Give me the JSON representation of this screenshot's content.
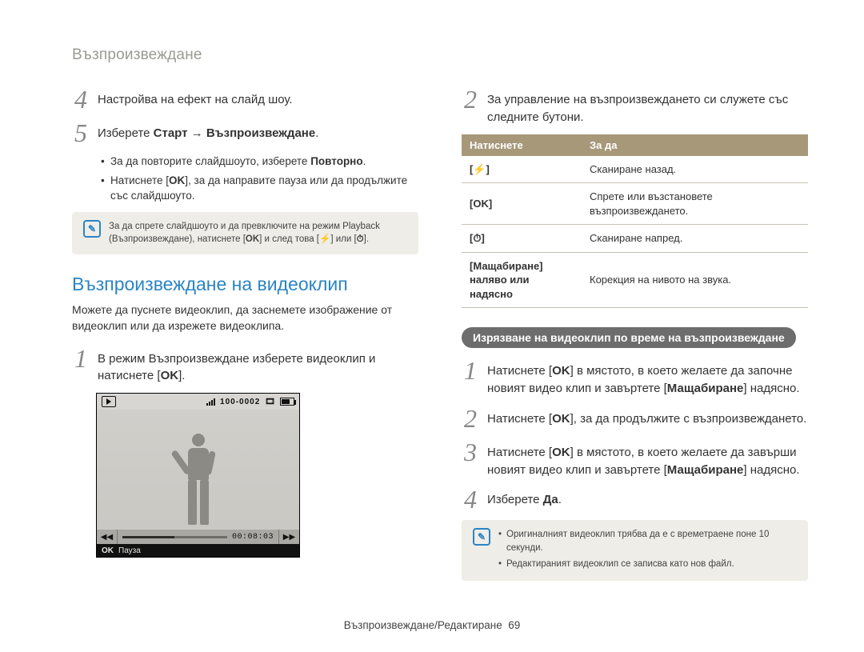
{
  "header": "Възпроизвеждане",
  "left": {
    "step4": "Настройва на ефект на слайд шоу.",
    "step5_pre": "Изберете ",
    "step5_b1": "Старт",
    "step5_arrow": " → ",
    "step5_b2": "Възпроизвеждане",
    "step5_post": ".",
    "bul1_pre": "За да повторите слайдшоуто, изберете ",
    "bul1_b": "Повторно",
    "bul1_post": ".",
    "bul2_pre": "Натиснете [",
    "bul2_ok": "OK",
    "bul2_post": "], за да направите пауза или да продължите със слайдшоуто.",
    "note1_pre": "За да спрете слайдшоуто и да превключите на режим Playback (Възпроизвеждане), натиснете [",
    "note1_ok": "OK",
    "note1_mid": "] и след това [",
    "note1_g1": "⚡",
    "note1_or": "] или [",
    "note1_g2": "⏱",
    "note1_post": "].",
    "h2": "Възпроизвеждане на видеоклип",
    "desc": "Можете да пуснете видеоклип, да заснемете изображение от видеоклип или да изрежете видеоклипа.",
    "step1_pre": "В режим Възпроизвеждане изберете видеоклип и натиснете [",
    "step1_ok": "OK",
    "step1_post": "].",
    "video": {
      "counter": "100-0002",
      "time": "00:08:03",
      "pause_ok": "OK",
      "pause_label": "Пауза"
    }
  },
  "right": {
    "step2": "За управление на възпроизвеждането си служете със следните бутони.",
    "th1": "Натиснете",
    "th2": "За да",
    "r1c1": "[⚡]",
    "r1c2": "Сканиране назад.",
    "r2c1": "[OK]",
    "r2c2": "Спрете или възстановете възпроизвеждането.",
    "r3c1": "[⏱]",
    "r3c2": "Сканиране напред.",
    "r4c1a": "[Мащабиране]",
    "r4c1b": "наляво или надясно",
    "r4c2": "Корекция на нивото на звука.",
    "pill": "Изрязване на видеоклип по време на възпроизвеждане",
    "t1_pre": "Натиснете [",
    "t1_ok": "OK",
    "t1_mid": "] в мястото, в което желаете да започне новият видео клип и завъртете [",
    "t1_b": "Мащабиране",
    "t1_post": "] надясно.",
    "t2_pre": "Натиснете [",
    "t2_ok": "OK",
    "t2_post": "], за да продължите с възпроизвеждането.",
    "t3_pre": "Натиснете [",
    "t3_ok": "OK",
    "t3_mid": "] в мястото, в което желаете да завърши новият видео клип и завъртете [",
    "t3_b": "Мащабиране",
    "t3_post": "] надясно.",
    "t4_pre": "Изберете ",
    "t4_b": "Да",
    "t4_post": ".",
    "note2_li1": "Оригиналният видеоклип трябва да е с времетраене поне 10 секунди.",
    "note2_li2": "Редактираният видеоклип се записва като нов файл."
  },
  "footer_text": "Възпроизвеждане/Редактиране",
  "footer_page": "69"
}
